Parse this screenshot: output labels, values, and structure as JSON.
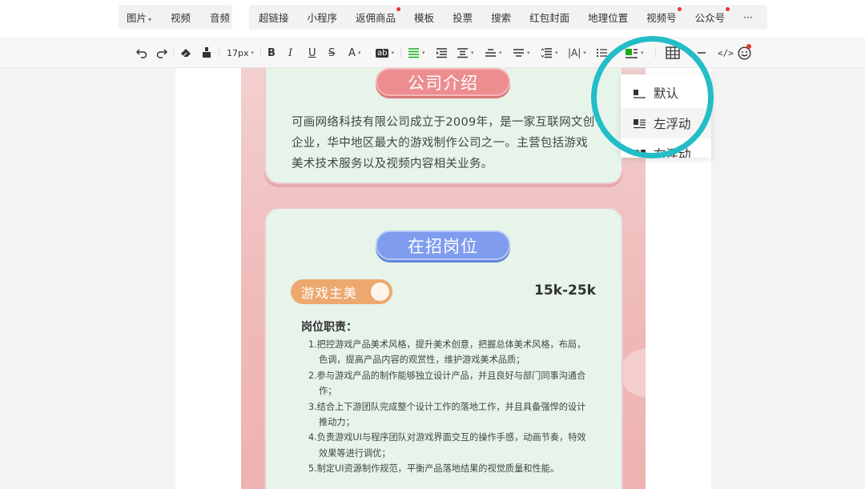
{
  "insert_bar": {
    "left_group": [
      {
        "label": "图片",
        "caret": "▾"
      },
      {
        "label": "视频"
      },
      {
        "label": "音频"
      }
    ],
    "right_group": [
      {
        "label": "超链接"
      },
      {
        "label": "小程序"
      },
      {
        "label": "返佣商品",
        "new": true
      },
      {
        "label": "模板"
      },
      {
        "label": "投票"
      },
      {
        "label": "搜索"
      },
      {
        "label": "红包封面"
      },
      {
        "label": "地理位置"
      },
      {
        "label": "视频号",
        "new": true
      },
      {
        "label": "公众号",
        "new": true
      }
    ],
    "more": "···"
  },
  "toolbar": {
    "font_size": "17px",
    "bold": "B",
    "italic": "I",
    "underline": "U",
    "strike": "S",
    "font_color": "A",
    "bg_color": "ab",
    "letter_spacing": "|A|"
  },
  "dropdown": {
    "items": [
      "默认",
      "左浮动",
      "右浮动"
    ]
  },
  "poster": {
    "section1_title": "公司介绍",
    "intro": "可画网络科技有限公司成立于2009年，是一家互联网文创企业，华中地区最大的游戏制作公司之一。主营包括游戏美术技术服务以及视频内容相关业务。",
    "section2_title": "在招岗位",
    "job": {
      "name": "游戏主美",
      "salary": "15k-25k",
      "duty_title": "岗位职责：",
      "duties": [
        "1.把控游戏产品美术风格，提升美术创意，把握总体美术风格，布局，色调，提高产品内容的观赏性，维护游戏美术品质；",
        "2.参与游戏产品的制作能够独立设计产品，并且良好与部门同事沟通合作；",
        "3.结合上下游团队完成整个设计工作的落地工作，并且具备强悍的设计推动力；",
        "4.负责游戏UI与程序团队对游戏界面交互的操作手感，动画节奏，特效效果等进行调优；",
        "5.制定UI资源制作规范，平衡产品落地结果的视觉质量和性能。"
      ]
    }
  },
  "colors": {
    "highlight_ring": "#22bdc6",
    "new_dot": "#e3382f",
    "card_bg": "#e6f4ea",
    "red_title": "#ec8d8f",
    "blue_title": "#7f9cef",
    "job_tag": "#eda86f"
  }
}
